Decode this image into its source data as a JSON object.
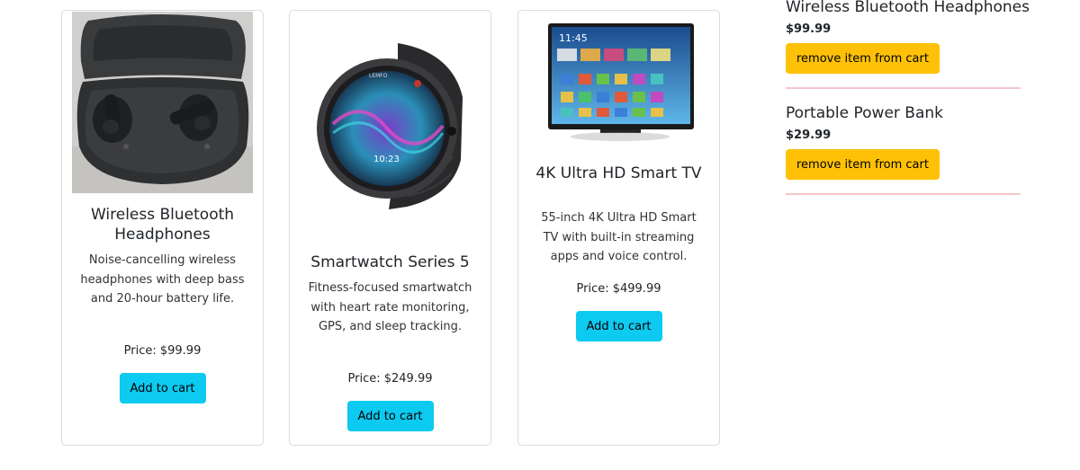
{
  "products": [
    {
      "title": "Wireless Bluetooth Headphones",
      "description": "Noise-cancelling wireless headphones with deep bass and 20-hour battery life.",
      "price": "Price: $99.99",
      "button": "Add to cart",
      "image_icon": "earbuds-case-image"
    },
    {
      "title": "Smartwatch Series 5",
      "description": "Fitness-focused smartwatch with heart rate monitoring, GPS, and sleep tracking.",
      "price": "Price: $249.99",
      "button": "Add to cart",
      "image_icon": "smartwatch-image",
      "watch_brand": "LEMFO",
      "watch_time": "10:23"
    },
    {
      "title": "4K Ultra HD Smart TV",
      "description": "55-inch 4K Ultra HD Smart TV with built-in streaming apps and voice control.",
      "price": "Price: $499.99",
      "button": "Add to cart",
      "image_icon": "smart-tv-image",
      "tv_time": "11:45"
    }
  ],
  "cart": [
    {
      "name": "Wireless Bluetooth Headphones",
      "price": "$99.99",
      "button": "remove item from cart"
    },
    {
      "name": "Portable Power Bank",
      "price": "$29.99",
      "button": "remove item from cart"
    }
  ],
  "colors": {
    "add_button": "#0dcaf0",
    "remove_button": "#ffc107",
    "divider": "#f5c6cb",
    "card_border": "#dcdcdc"
  }
}
